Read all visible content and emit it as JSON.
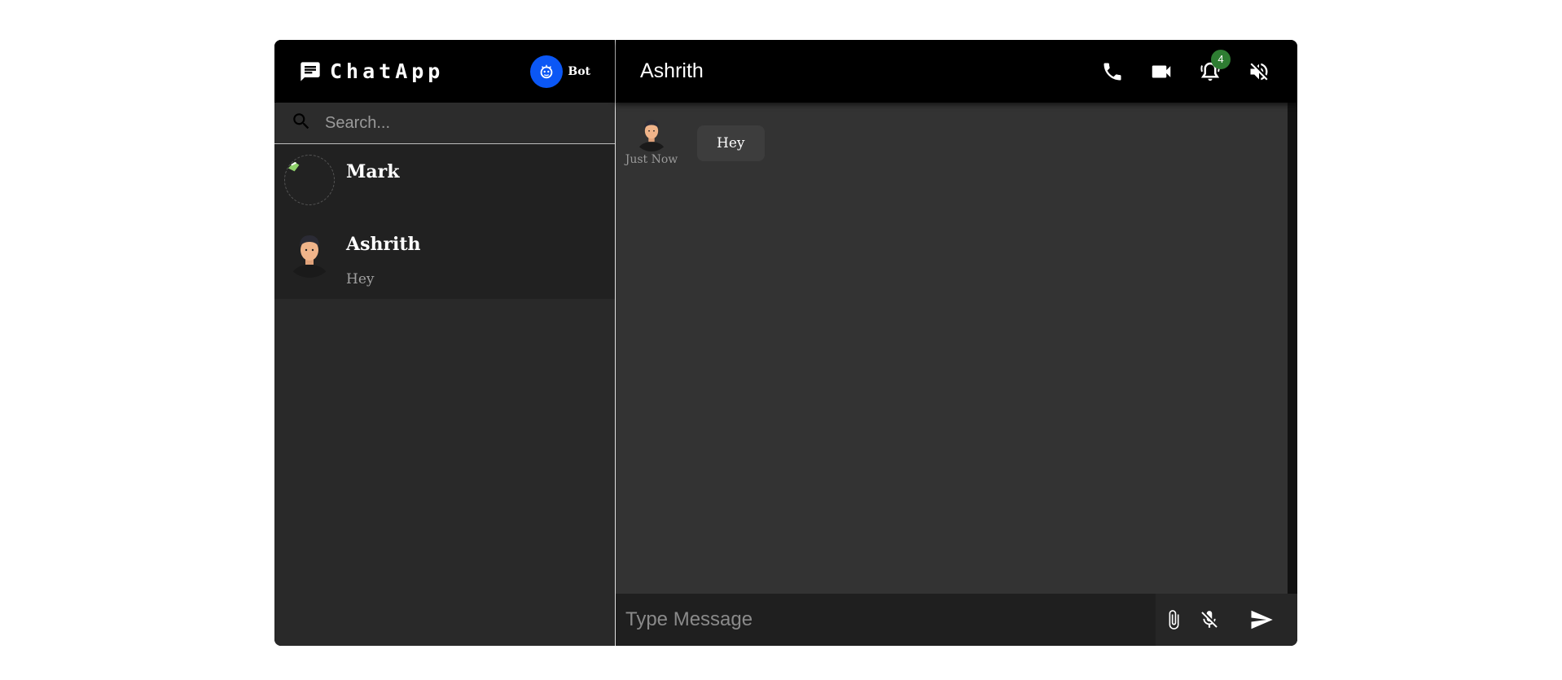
{
  "sidebar": {
    "brand_name": "ChatApp",
    "bot_label": "Bot",
    "search_placeholder": "Search...",
    "contacts": [
      {
        "name": "Mark",
        "last_message": ""
      },
      {
        "name": "Ashrith",
        "last_message": "Hey"
      }
    ]
  },
  "chat": {
    "title": "Ashrith",
    "notification_count": "4",
    "messages": [
      {
        "text": "Hey",
        "time": "Just Now"
      }
    ],
    "composer_placeholder": "Type Message"
  },
  "icons": {
    "brand": "chat-bubble-icon",
    "bot": "bot-face-icon",
    "search": "search-icon",
    "call": "phone-icon",
    "video": "video-camera-icon",
    "notifications": "bell-icon",
    "mute": "volume-off-icon",
    "attach": "paperclip-icon",
    "mic": "mic-off-icon",
    "send": "send-icon"
  },
  "colors": {
    "bot_accent": "#0b57f5",
    "badge": "#2e7d32",
    "header_bg": "#000000",
    "chat_bg": "#333333"
  }
}
